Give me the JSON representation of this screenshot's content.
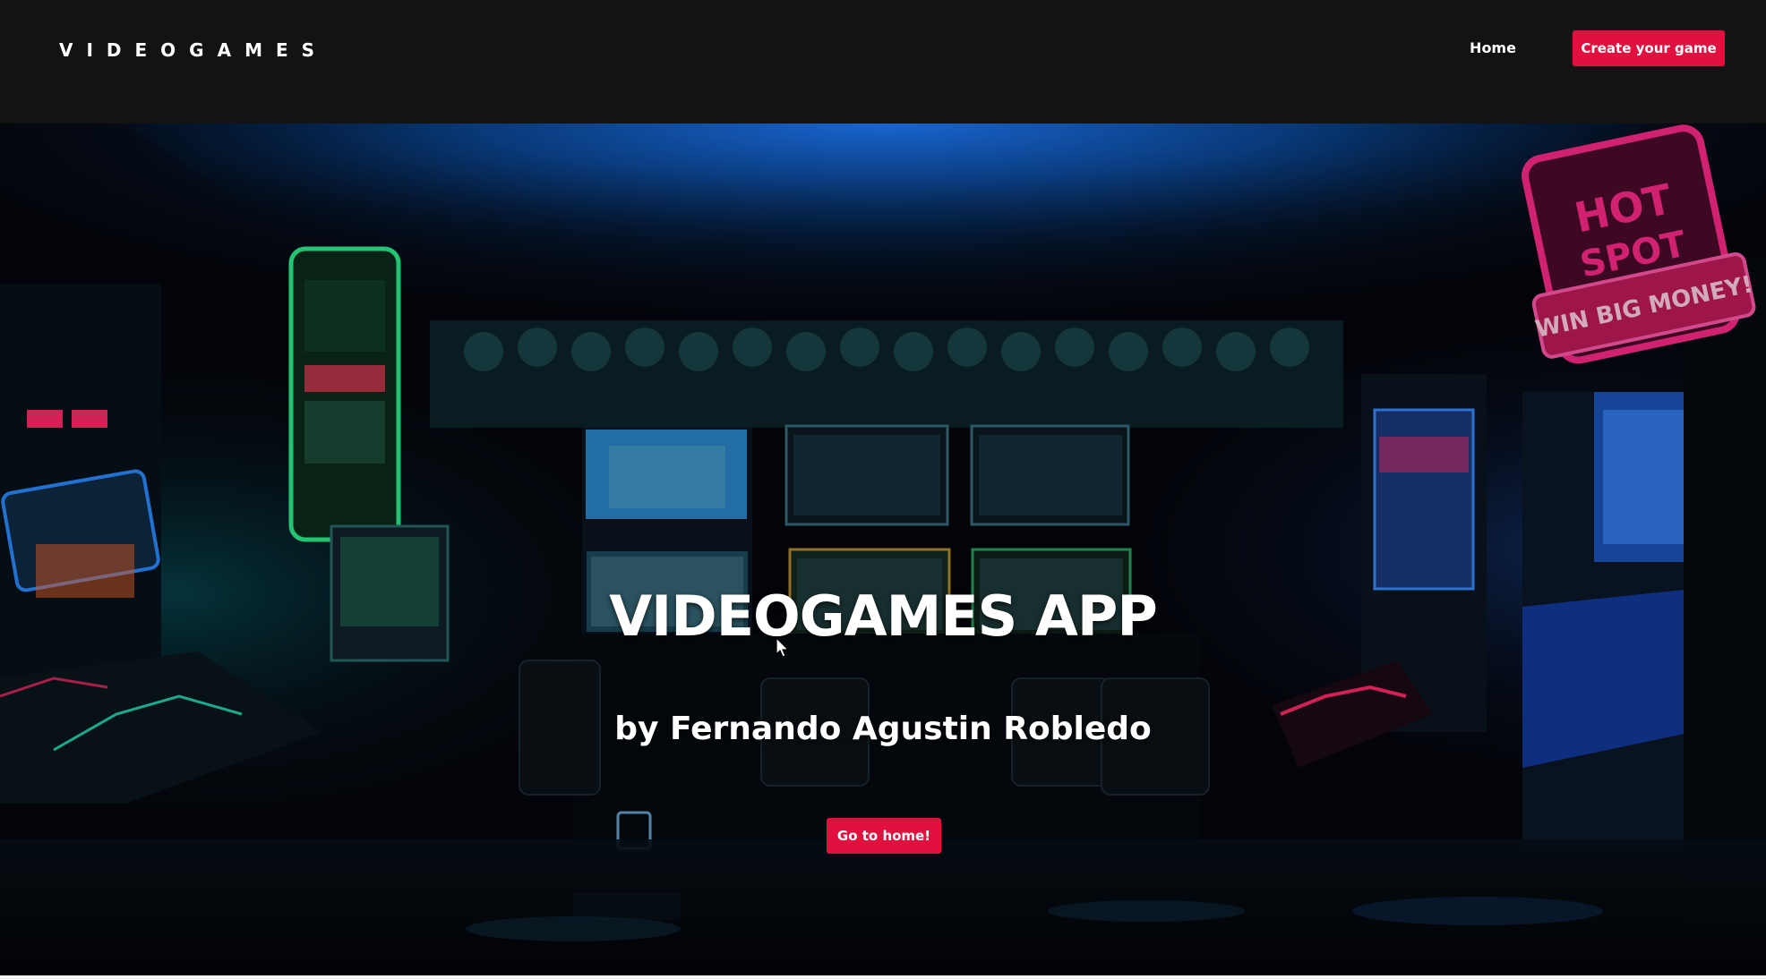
{
  "navbar": {
    "brand": "VIDEOGAMES",
    "home_label": "Home",
    "create_label": "Create your game"
  },
  "hero": {
    "title": "VIDEOGAMES APP",
    "subtitle": "by Fernando Agustin Robledo",
    "button_label": "Go to home!",
    "background": "arcade-room-photo"
  },
  "colors": {
    "navbar_bg": "#131313",
    "accent": "#e0113e",
    "text": "#ffffff"
  },
  "icons": {
    "cursor": "mouse-pointer-icon"
  }
}
